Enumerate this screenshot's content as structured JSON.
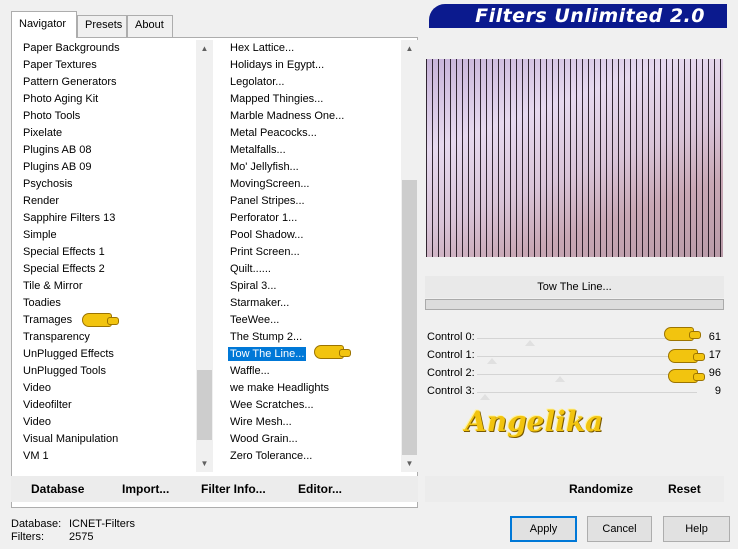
{
  "tabs": [
    {
      "label": "Navigator",
      "active": true
    },
    {
      "label": "Presets",
      "active": false
    },
    {
      "label": "About",
      "active": false
    }
  ],
  "banner_title": "Filters Unlimited 2.0",
  "categories": [
    "Paper Backgrounds",
    "Paper Textures",
    "Pattern Generators",
    "Photo Aging Kit",
    "Photo Tools",
    "Pixelate",
    "Plugins AB 08",
    "Plugins AB 09",
    "Psychosis",
    "Render",
    "Sapphire Filters 13",
    "Simple",
    "Special Effects 1",
    "Special Effects 2",
    "Tile & Mirror",
    "Toadies",
    "Tramages",
    "Transparency",
    "UnPlugged Effects",
    "UnPlugged Tools",
    "Video",
    "Videofilter",
    "Video",
    "Visual Manipulation",
    "VM 1"
  ],
  "filters": [
    "Hex Lattice...",
    "Holidays in Egypt...",
    "Legolator...",
    "Mapped Thingies...",
    "Marble Madness One...",
    "Metal Peacocks...",
    "Metalfalls...",
    "Mo' Jellyfish...",
    "MovingScreen...",
    "Panel Stripes...",
    "Perforator 1...",
    "Pool Shadow...",
    "Print Screen...",
    "Quilt......",
    "Spiral 3...",
    "Starmaker...",
    "TeeWee...",
    "The Stump 2...",
    "Tow The Line...",
    "Waffle...",
    "we make Headlights",
    "Wee Scratches...",
    "Wire Mesh...",
    "Wood Grain...",
    "Zero Tolerance..."
  ],
  "selected_filter_index": 18,
  "filter_name": "Tow The Line...",
  "controls": [
    {
      "label": "Control 0:",
      "value": "61",
      "level": 61
    },
    {
      "label": "Control 1:",
      "value": "17",
      "level": 17
    },
    {
      "label": "Control 2:",
      "value": "96",
      "level": 96
    },
    {
      "label": "Control 3:",
      "value": "9",
      "level": 9
    }
  ],
  "toolbar": {
    "database": "Database",
    "import": "Import...",
    "filter_info": "Filter Info...",
    "editor": "Editor...",
    "randomize": "Randomize",
    "reset": "Reset"
  },
  "status": {
    "database_label": "Database:",
    "database_value": "ICNET-Filters",
    "filters_label": "Filters:",
    "filters_value": "2575"
  },
  "buttons": {
    "apply": "Apply",
    "cancel": "Cancel",
    "help": "Help"
  },
  "signature": "Angelika",
  "colors": {
    "banner": "#0b1a8e",
    "selection": "#0078d7",
    "accent": "#f2c40f"
  }
}
